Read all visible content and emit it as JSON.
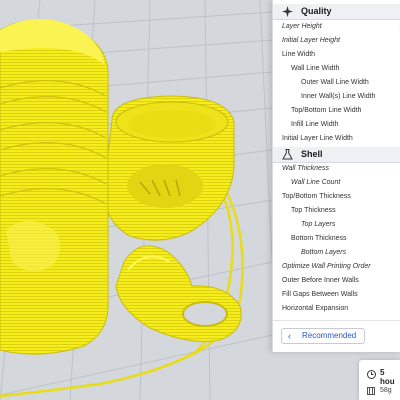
{
  "settings_panel": {
    "quality": {
      "title": "Quality",
      "items": [
        {
          "label": "Layer Height"
        },
        {
          "label": "Initial Layer Height"
        },
        {
          "label": "Line Width"
        },
        {
          "label": "Wall Line Width"
        },
        {
          "label": "Outer Wall Line Width"
        },
        {
          "label": "Inner Wall(s) Line Width"
        },
        {
          "label": "Top/Bottom Line Width"
        },
        {
          "label": "Infill Line Width"
        },
        {
          "label": "Initial Layer Line Width"
        }
      ]
    },
    "shell": {
      "title": "Shell",
      "items": [
        {
          "label": "Wall Thickness"
        },
        {
          "label": "Wall Line Count"
        },
        {
          "label": "Top/Bottom Thickness"
        },
        {
          "label": "Top Thickness"
        },
        {
          "label": "Top Layers"
        },
        {
          "label": "Bottom Thickness"
        },
        {
          "label": "Bottom Layers"
        },
        {
          "label": "Optimize Wall Printing Order"
        },
        {
          "label": "Outer Before Inner Walls"
        },
        {
          "label": "Fill Gaps Between Walls"
        },
        {
          "label": "Horizontal Expansion"
        }
      ]
    },
    "recommended_button": "Recommended"
  },
  "print_estimate": {
    "time": "5 hou",
    "weight": "58g"
  },
  "colors": {
    "model": "#f5ea16",
    "build_plate": "#d4d8dd",
    "accent": "#2b55c4"
  },
  "icons": {
    "quality_icon": "sparkle-icon",
    "shell_icon": "flask-icon",
    "time_icon": "clock-icon",
    "spool_icon": "spool-icon"
  }
}
